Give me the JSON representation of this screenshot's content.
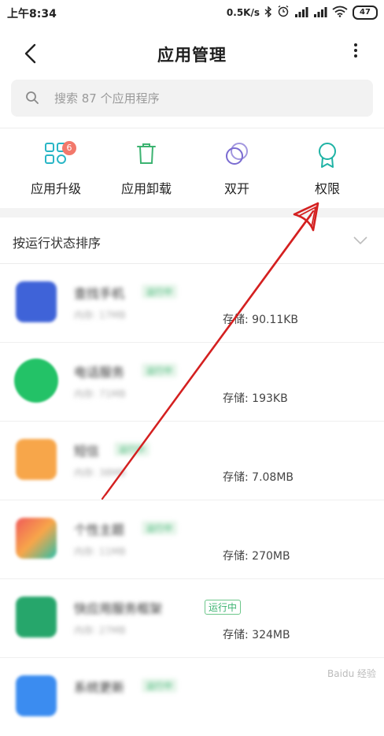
{
  "status_bar": {
    "time": "上午8:34",
    "net_speed": "0.5K/s",
    "battery": "47"
  },
  "header": {
    "title": "应用管理",
    "back_icon": "chevron-left-icon",
    "more_icon": "more-vertical-icon"
  },
  "search": {
    "placeholder": "搜索 87 个应用程序",
    "icon": "search-icon"
  },
  "tools": [
    {
      "label": "应用升级",
      "icon": "grid-apps-icon",
      "badge": "6",
      "color": "#29b6c6"
    },
    {
      "label": "应用卸载",
      "icon": "trash-icon",
      "color": "#3cb371"
    },
    {
      "label": "双开",
      "icon": "dual-circle-icon",
      "color": "#7a6bd1"
    },
    {
      "label": "权限",
      "icon": "ribbon-icon",
      "color": "#1fb3a5"
    }
  ],
  "sort": {
    "label": "按运行状态排序",
    "icon": "chevron-down-icon"
  },
  "apps": [
    {
      "name": "查找手机",
      "tag": "运行中",
      "sub": "内存: 17MB",
      "storage": "存储: 90.11KB",
      "icon_color": "#3f63d8"
    },
    {
      "name": "电话服务",
      "tag": "运行中",
      "sub": "内存: 71MB",
      "storage": "存储: 193KB",
      "icon_color": "#23c267"
    },
    {
      "name": "短信",
      "tag": "运行中",
      "sub": "内存: 38MB",
      "storage": "存储: 7.08MB",
      "icon_color": "#f7a64a"
    },
    {
      "name": "个性主题",
      "tag": "运行中",
      "sub": "内存: 11MB",
      "storage": "存储: 270MB",
      "icon_color": "#f05a5a"
    },
    {
      "name": "快应用服务框架",
      "tag": "运行中",
      "sub": "内存: 27MB",
      "storage": "存储: 324MB",
      "icon_color": "#26a66b"
    },
    {
      "name": "系统更新",
      "tag": "运行中",
      "sub": "",
      "storage": "",
      "icon_color": "#3b8cf0"
    }
  ],
  "watermark": "Baidu 经验",
  "colors": {
    "accent_teal": "#1fb3a5",
    "arrow_red": "#d42020",
    "badge_red": "#f2786b"
  }
}
